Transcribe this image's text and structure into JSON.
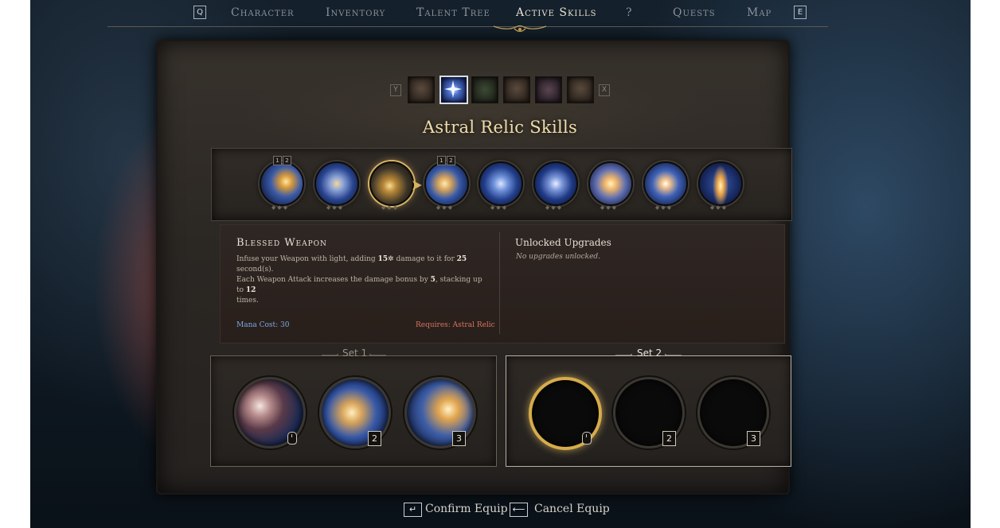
{
  "nav": {
    "left_key": "Q",
    "right_key": "E",
    "tabs": [
      {
        "label": "Character"
      },
      {
        "label": "Inventory"
      },
      {
        "label": "Talent Tree"
      },
      {
        "label": "Active Skills",
        "active": true
      },
      {
        "label": "?"
      },
      {
        "label": "Quests"
      },
      {
        "label": "Map"
      }
    ]
  },
  "categories": {
    "prev_key": "Y",
    "next_key": "X",
    "items": [
      {
        "icon": "claw-icon"
      },
      {
        "icon": "astral-star-icon",
        "selected": true
      },
      {
        "icon": "nature-icon"
      },
      {
        "icon": "beast-icon"
      },
      {
        "icon": "shadow-burst-icon"
      },
      {
        "icon": "fist-icon"
      }
    ]
  },
  "panel": {
    "title": "Astral Relic Skills"
  },
  "skills": [
    {
      "icon": "astral-strike-icon",
      "slots": [
        "1",
        "2"
      ]
    },
    {
      "icon": "astral-vortex-icon"
    },
    {
      "icon": "blessed-weapon-icon",
      "selected": true
    },
    {
      "icon": "hammer-icon",
      "slots": [
        "1",
        "2"
      ]
    },
    {
      "icon": "light-figure-icon"
    },
    {
      "icon": "holy-shield-icon"
    },
    {
      "icon": "radiant-hand-icon"
    },
    {
      "icon": "star-burst-icon"
    },
    {
      "icon": "light-pillar-icon"
    }
  ],
  "detail": {
    "name": "Blessed Weapon",
    "desc_1": "Infuse your Weapon with light, adding",
    "damage": "15",
    "desc_2": "damage to it for",
    "duration": "25",
    "desc_3": "second(s).",
    "desc_4": "Each Weapon Attack increases the damage bonus by",
    "bonus": "5",
    "desc_5": ", stacking up to",
    "stacks": "12",
    "desc_6": "times.",
    "mana_cost": "Mana Cost: 30",
    "requires": "Requires: Astral Relic",
    "upgrades_title": "Unlocked Upgrades",
    "upgrades_text": "No upgrades unlocked."
  },
  "sets": [
    {
      "title": "Set 1",
      "slots": [
        {
          "icon": "blessed-weapon-icon",
          "key": "mouse"
        },
        {
          "icon": "hammer-icon",
          "key": "2"
        },
        {
          "icon": "astral-strike-icon",
          "key": "3"
        }
      ]
    },
    {
      "title": "Set 2",
      "active": true,
      "slots": [
        {
          "icon": "empty-slot",
          "key": "mouse",
          "highlight": true
        },
        {
          "icon": "empty-slot",
          "key": "2"
        },
        {
          "icon": "empty-slot",
          "key": "3"
        }
      ]
    }
  ],
  "footer": {
    "confirm_key": "↵",
    "confirm_label": "Confirm Equip",
    "cancel_key": "⟵",
    "cancel_label": "Cancel Equip"
  },
  "colors": {
    "title_gold": "#f1dcaa",
    "mana_blue": "#7fa6e6",
    "requires_red": "#d8735e",
    "highlight_gold": "#d6ac4a"
  }
}
